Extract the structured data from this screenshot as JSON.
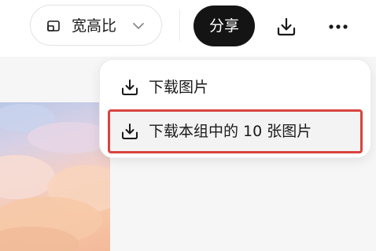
{
  "toolbar": {
    "aspect_label": "宽高比",
    "share_label": "分享",
    "icons": {
      "aspect": "aspect-ratio-icon",
      "chevron": "chevron-down-icon",
      "download": "download-icon",
      "more": "more-icon"
    }
  },
  "menu": {
    "items": [
      {
        "label": "下载图片",
        "icon": "download-icon"
      },
      {
        "label": "下载本组中的 10 张图片",
        "icon": "download-icon",
        "highlighted": true
      }
    ]
  },
  "colors": {
    "share_bg": "#141414",
    "highlight_border": "#d9433f",
    "content_bg": "#f6f6f6"
  }
}
